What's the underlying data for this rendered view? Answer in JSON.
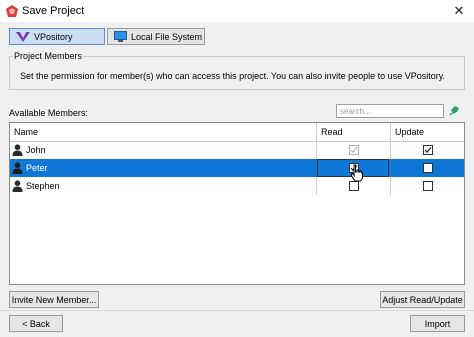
{
  "window": {
    "title": "Save Project"
  },
  "tabs": [
    {
      "label": "VPository",
      "active": true
    },
    {
      "label": "Local File System",
      "active": false
    }
  ],
  "project_members": {
    "legend": "Project Members",
    "description": "Set the permission for member(s) who can access this project. You can also invite people to use VPository."
  },
  "available_members": {
    "label": "Available Members:",
    "search_placeholder": "search..."
  },
  "table": {
    "columns": [
      "Name",
      "Read",
      "Update"
    ],
    "rows": [
      {
        "name": "John",
        "read": true,
        "read_enabled": false,
        "update": true,
        "selected": false
      },
      {
        "name": "Peter",
        "read": true,
        "read_enabled": true,
        "update": false,
        "selected": true
      },
      {
        "name": "Stephen",
        "read": false,
        "read_enabled": true,
        "update": false,
        "selected": false
      }
    ]
  },
  "buttons": {
    "invite": "Invite New Member...",
    "adjust": "Adjust Read/Update",
    "back": "< Back",
    "import": "Import"
  },
  "colors": {
    "selection": "#0f78d7",
    "active_tab": "#c9ddf3",
    "brand_purple": "#7b3fb0"
  }
}
